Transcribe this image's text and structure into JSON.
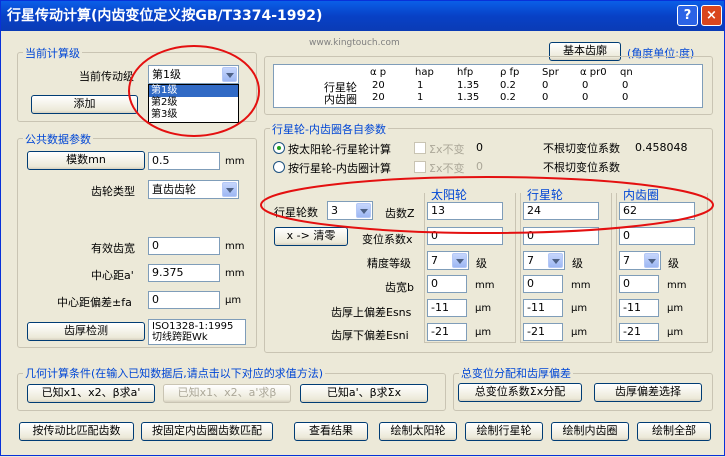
{
  "window": {
    "title": "行星传动计算(内齿变位定义按GB/T3374-1992)",
    "help": "?",
    "close": "×"
  },
  "watermark": "www.kingtouch.com",
  "stage": {
    "group_title": "当前计算级",
    "label": "当前传动级",
    "selected": "第1级",
    "options": [
      "第1级",
      "第2级",
      "第3级"
    ],
    "add_button": "添加"
  },
  "common": {
    "group_title": "公共数据参数",
    "module_button": "模数mn",
    "module_value": "0.5",
    "module_unit": "mm",
    "gear_type_label": "齿轮类型",
    "gear_type_value": "直齿齿轮",
    "eff_depth_label": "有效齿宽",
    "eff_depth_value": "0",
    "eff_depth_unit": "mm",
    "center_label": "中心距a'",
    "center_value": "9.375",
    "center_unit": "mm",
    "dev_label": "中心距偏差±fa",
    "dev_value": "0",
    "dev_unit": "μm",
    "check_button": "齿厚检测",
    "check_value1": "ISO1328-1:1995",
    "check_value2": "切线跨距Wk"
  },
  "basic_button": "基本齿廓",
  "angle_unit": "(角度单位:度)",
  "param_table": {
    "headers": [
      "α p",
      "hap",
      "hfp",
      "ρ fp",
      "Spr",
      "α pr0",
      "qn"
    ],
    "rows": [
      {
        "name": "行星轮",
        "values": [
          "20",
          "1",
          "1.35",
          "0.2",
          "0",
          "0",
          "0"
        ]
      },
      {
        "name": "内齿圈",
        "values": [
          "20",
          "1",
          "1.35",
          "0.2",
          "0",
          "0",
          "0"
        ]
      }
    ]
  },
  "shift": {
    "group_title": "行星轮-内齿圈各自参数",
    "radio1": "按太阳轮-行星轮计算",
    "radio2": "按行星轮-内齿圈计算",
    "sum_label": "Σx不变",
    "sum_value": "0",
    "nocut_label": "不根切变位系数",
    "nocut_value": "0.458048",
    "nocut_label2": "不根切变位系数"
  },
  "gears": {
    "count_label": "行星轮数",
    "count_value": "3",
    "teeth_label": "齿数Z",
    "clear_button": "x -> 清零",
    "shift_label": "变位系数x",
    "grade_label": "精度等级",
    "width_label": "齿宽b",
    "esns_label": "齿厚上偏差Esns",
    "esni_label": "齿厚下偏差Esni",
    "grade_unit": "级",
    "width_unit": "mm",
    "dev_unit": "μm",
    "columns": [
      {
        "name": "太阳轮",
        "teeth": "13",
        "shift": "0",
        "grade": "7",
        "width": "0",
        "esns": "-11",
        "esni": "-21"
      },
      {
        "name": "行星轮",
        "teeth": "24",
        "shift": "0",
        "grade": "7",
        "width": "0",
        "esns": "-11",
        "esni": "-21"
      },
      {
        "name": "内齿圈",
        "teeth": "62",
        "shift": "0",
        "grade": "7",
        "width": "0",
        "esns": "-11",
        "esni": "-21"
      }
    ]
  },
  "geometry": {
    "group_title": "几何计算条件(在输入已知数据后,请点击以下对应的求值方法)",
    "btn1": "已知x1、x2、β求a'",
    "btn2": "已知x1、x2、a'求β",
    "btn3": "已知a'、β求Σx"
  },
  "total_shift": {
    "group_title": "总变位分配和齿厚偏差",
    "btn1": "总变位系数Σx分配",
    "btn2": "齿厚偏差选择"
  },
  "bottom": [
    "按传动比匹配齿数",
    "按固定内齿圈齿数匹配",
    "查看结果",
    "绘制太阳轮",
    "绘制行星轮",
    "绘制内齿圈",
    "绘制全部"
  ]
}
